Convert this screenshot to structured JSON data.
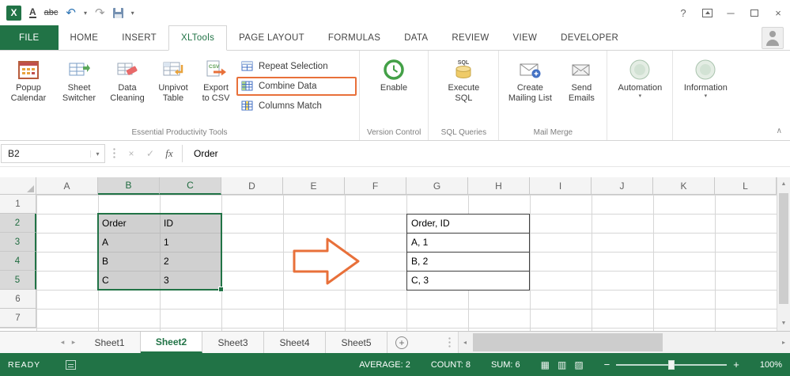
{
  "tabs": [
    "FILE",
    "HOME",
    "INSERT",
    "XLTools",
    "PAGE LAYOUT",
    "FORMULAS",
    "DATA",
    "REVIEW",
    "VIEW",
    "DEVELOPER"
  ],
  "qat": {
    "underline": "A",
    "strikethrough": "abc"
  },
  "titlebar": {
    "help": "?",
    "minimize": "─",
    "close": "×"
  },
  "icons": {
    "dropdown": "▾",
    "up": "▲",
    "down": "▼",
    "small_left": "◂",
    "small_right": "▸",
    "collapse": "∧",
    "undo": "↶",
    "redo": "↷",
    "view_normal": "▦",
    "view_layout": "▥",
    "view_break": "▨"
  },
  "ribbon": {
    "buttons": {
      "popup_calendar": [
        "Popup",
        "Calendar"
      ],
      "sheet_switcher": [
        "Sheet",
        "Switcher"
      ],
      "data_cleaning": [
        "Data",
        "Cleaning"
      ],
      "unpivot_table": [
        "Unpivot",
        "Table"
      ],
      "export_to_csv": [
        "Export",
        "to CSV"
      ],
      "repeat_selection": "Repeat Selection",
      "combine_data": "Combine Data",
      "columns_match": "Columns Match",
      "enable": "Enable",
      "execute_sql": [
        "Execute",
        "SQL"
      ],
      "create_mailing_list": [
        "Create",
        "Mailing List"
      ],
      "send_emails": [
        "Send",
        "Emails"
      ],
      "automation": "Automation",
      "information": "Information"
    },
    "group_labels": {
      "productivity": "Essential Productivity Tools",
      "version_control": "Version Control",
      "sql_queries": "SQL Queries",
      "mail_merge": "Mail Merge"
    },
    "sql_icon_text": "SQL",
    "csv_icon_text": "CSV"
  },
  "formula_bar": {
    "name_box": "B2",
    "cancel": "×",
    "enter": "✓",
    "fx": "fx",
    "content": "Order"
  },
  "grid": {
    "columns": [
      "A",
      "B",
      "C",
      "D",
      "E",
      "F",
      "G",
      "H",
      "I",
      "J",
      "K",
      "L"
    ],
    "rows": [
      "1",
      "2",
      "3",
      "4",
      "5",
      "6",
      "7"
    ],
    "cells": {
      "B2": "Order",
      "C2": "ID",
      "B3": "A",
      "C3": "1",
      "B4": "B",
      "C4": "2",
      "B5": "C",
      "C5": "3"
    },
    "results": [
      "Order, ID",
      "A, 1",
      "B, 2",
      "C, 3"
    ]
  },
  "sheets": {
    "tabs": [
      "Sheet1",
      "Sheet2",
      "Sheet3",
      "Sheet4",
      "Sheet5"
    ],
    "add": "+"
  },
  "status": {
    "mode": "READY",
    "average": "AVERAGE: 2",
    "count": "COUNT: 8",
    "sum": "SUM: 6",
    "zoom_out": "−",
    "zoom_in": "+",
    "zoom": "100%"
  },
  "colors": {
    "excel_green": "#217346",
    "highlight_orange": "#E8703A",
    "selection_fill": "#D0D0D0"
  }
}
